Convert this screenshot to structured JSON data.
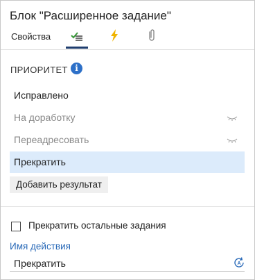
{
  "header": {
    "title": "Блок \"Расширенное задание\""
  },
  "tabs": [
    {
      "label": "Свойства",
      "icon": "properties-tab-text",
      "active": false
    },
    {
      "label": "",
      "icon": "checklist-icon",
      "active": true
    },
    {
      "label": "",
      "icon": "lightning-icon",
      "active": false
    },
    {
      "label": "",
      "icon": "paperclip-icon",
      "active": false
    }
  ],
  "priority": {
    "title": "ПРИОРИТЕТ",
    "info_icon": "info-icon",
    "results": [
      {
        "label": "Исправлено",
        "state": "active",
        "icon": ""
      },
      {
        "label": "На доработку",
        "state": "muted",
        "icon": "eye-closed-icon"
      },
      {
        "label": "Переадресовать",
        "state": "muted",
        "icon": "eye-closed-icon"
      },
      {
        "label": "Прекратить",
        "state": "selected",
        "icon": ""
      }
    ],
    "add_button_label": "Добавить результат"
  },
  "options": {
    "stop_others_label": "Прекратить остальные задания",
    "stop_others_checked": false,
    "action_name_label": "Имя действия",
    "action_name_value": "Прекратить",
    "refresh_icon": "refresh-icon"
  },
  "colors": {
    "accent": "#2a6ab8",
    "tab_underline": "#1f3d6e",
    "selected_row": "#dcebfb",
    "lightning": "#f0b400",
    "checklist_green": "#3a9a3a"
  }
}
